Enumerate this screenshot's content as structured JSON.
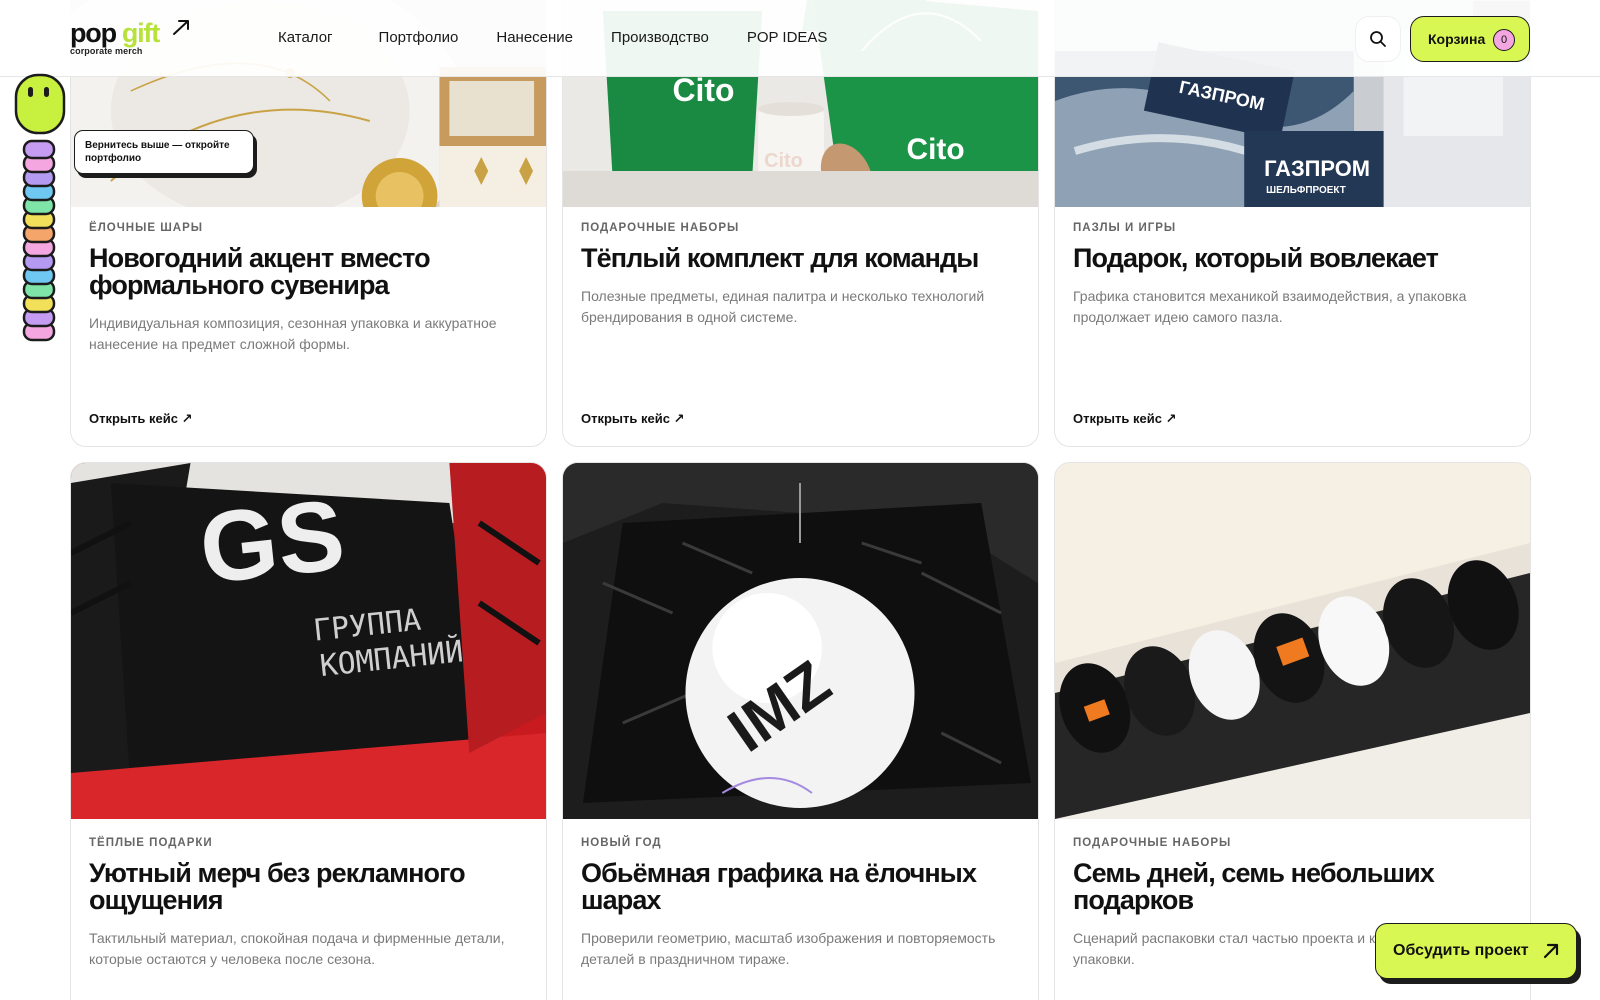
{
  "header": {
    "logo": {
      "pop": "pop",
      "gift": "gift",
      "sub": "corporate merch"
    },
    "nav": [
      "Каталог",
      "Портфолио",
      "Нанесение",
      "Производство",
      "POP IDEAS"
    ],
    "cart": {
      "label": "Корзина",
      "count": "0"
    },
    "icons": {
      "search": "search-icon",
      "logo_arrow": "arrow-up-right-icon"
    }
  },
  "mascot": {
    "icon": "caterpillar-icon",
    "tooltip": "Вернитесь выше — откройте портфолио"
  },
  "cards": [
    {
      "tag": "Ёлочные шары",
      "title": "Новогодний акцент вместо формального сувенира",
      "desc": "Индивидуальная композиция, сезонная упаковка и аккуратное нанесение на предмет сложной формы.",
      "link": "Открыть кейс ↗"
    },
    {
      "tag": "Подарочные наборы",
      "title": "Тёплый комплект для команды",
      "desc": "Полезные предметы, единая палитра и несколько технологий брендирования в одной системе.",
      "link": "Открыть кейс ↗",
      "photo_text": "Cito"
    },
    {
      "tag": "Пазлы и игры",
      "title": "Подарок, который вовлекает",
      "desc": "Графика становится механикой взаимодействия, а упаковка продолжает идею самого пазла.",
      "link": "Открыть кейс ↗",
      "photo_text": [
        "ГАЗПРОМ",
        "ШЕЛЬФПРОЕКТ"
      ]
    },
    {
      "tag": "Тёплые подарки",
      "title": "Уютный мерч без рекламного ощущения",
      "desc": "Тактильный материал, спокойная подача и фирменные детали, которые остаются у человека после сезона.",
      "photo_text": [
        "GS",
        "ГРУППА",
        "КОМПАНИЙ"
      ]
    },
    {
      "tag": "Новый год",
      "title": "Обьёмная графика на ёлочных шарах",
      "desc": "Проверили геометрию, масштаб изображения и повторяемость деталей в праздничном тираже.",
      "photo_text": "IMZ"
    },
    {
      "tag": "Подарочные наборы",
      "title": "Семь дней, семь небольших подарков",
      "desc": "Сценарий распаковки стал частью проекта и конструкцией упаковки."
    }
  ],
  "cta": {
    "label": "Обсудить проект",
    "icon": "arrow-up-right-icon"
  },
  "colors": {
    "accent": "#d9f752",
    "accent_logo": "#b6e23a",
    "badge": "#f3a6df",
    "ink": "#1c1c1c"
  }
}
